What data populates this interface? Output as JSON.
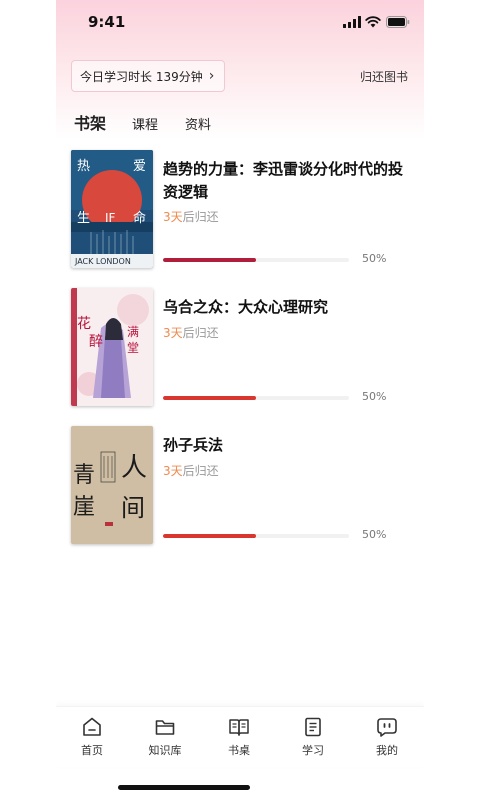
{
  "status_bar": {
    "time": "9:41"
  },
  "header": {
    "study_time": "今日学习时长 139分钟",
    "return_books": "归还图书"
  },
  "tabs": [
    {
      "label": "书架",
      "active": true
    },
    {
      "label": "课程",
      "active": false
    },
    {
      "label": "资料",
      "active": false
    }
  ],
  "books": [
    {
      "title": "趋势的力量：李迅雷谈分化时代的投资逻辑",
      "return_days": "3天",
      "return_suffix": "后归还",
      "progress": 0.5,
      "progress_label": "50%",
      "bar_color": "#b01e3c"
    },
    {
      "title": "乌合之众：大众心理研究",
      "return_days": "3天",
      "return_suffix": "后归还",
      "progress": 0.5,
      "progress_label": "50%",
      "bar_color": "#d9362f"
    },
    {
      "title": "孙子兵法",
      "return_days": "3天",
      "return_suffix": "后归还",
      "progress": 0.5,
      "progress_label": "50%",
      "bar_color": "#d9362f"
    }
  ],
  "nav": [
    {
      "label": "首页",
      "icon": "home-icon"
    },
    {
      "label": "知识库",
      "icon": "folder-icon"
    },
    {
      "label": "书桌",
      "icon": "open-book-icon"
    },
    {
      "label": "学习",
      "icon": "document-icon"
    },
    {
      "label": "我的",
      "icon": "profile-icon"
    }
  ],
  "colors": {
    "accent": "#c8193b",
    "days_highlight": "#ee8a4e"
  }
}
